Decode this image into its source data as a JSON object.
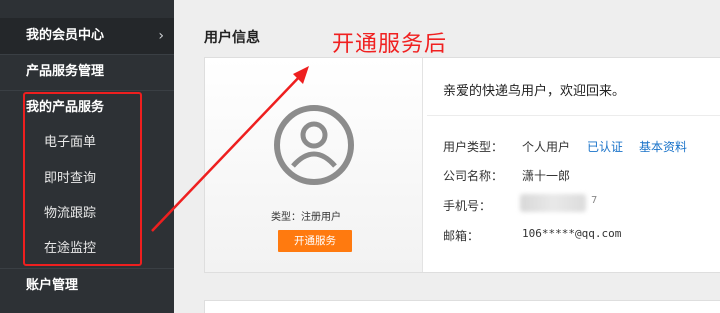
{
  "sidebar": {
    "items": [
      {
        "label": "我的会员中心"
      },
      {
        "label": "产品服务管理"
      },
      {
        "label": "我的产品服务"
      },
      {
        "label": "账户管理"
      }
    ],
    "sub_items": [
      {
        "label": "电子面单"
      },
      {
        "label": "即时查询"
      },
      {
        "label": "物流跟踪"
      },
      {
        "label": "在途监控"
      }
    ]
  },
  "main": {
    "section_title": "用户信息",
    "annotation": "开通服务后",
    "avatar": {
      "type_label": "类型：注册用户",
      "open_button": "开通服务"
    },
    "welcome": "亲爱的快递鸟用户，欢迎回来。",
    "info": {
      "user_type_label": "用户类型：",
      "user_type_value": "个人用户",
      "verified_link": "已认证",
      "basic_info_link": "基本资料",
      "company_label": "公司名称：",
      "company_value": "潇十一郎",
      "phone_label": "手机号：",
      "phone_tail": "7",
      "email_label": "邮箱：",
      "email_value": "106*****@qq.com"
    }
  },
  "colors": {
    "sidebar_bg": "#2d3135",
    "accent_orange": "#ff7a0f",
    "annotation_red": "#f02020",
    "link_blue": "#1a73c9"
  }
}
